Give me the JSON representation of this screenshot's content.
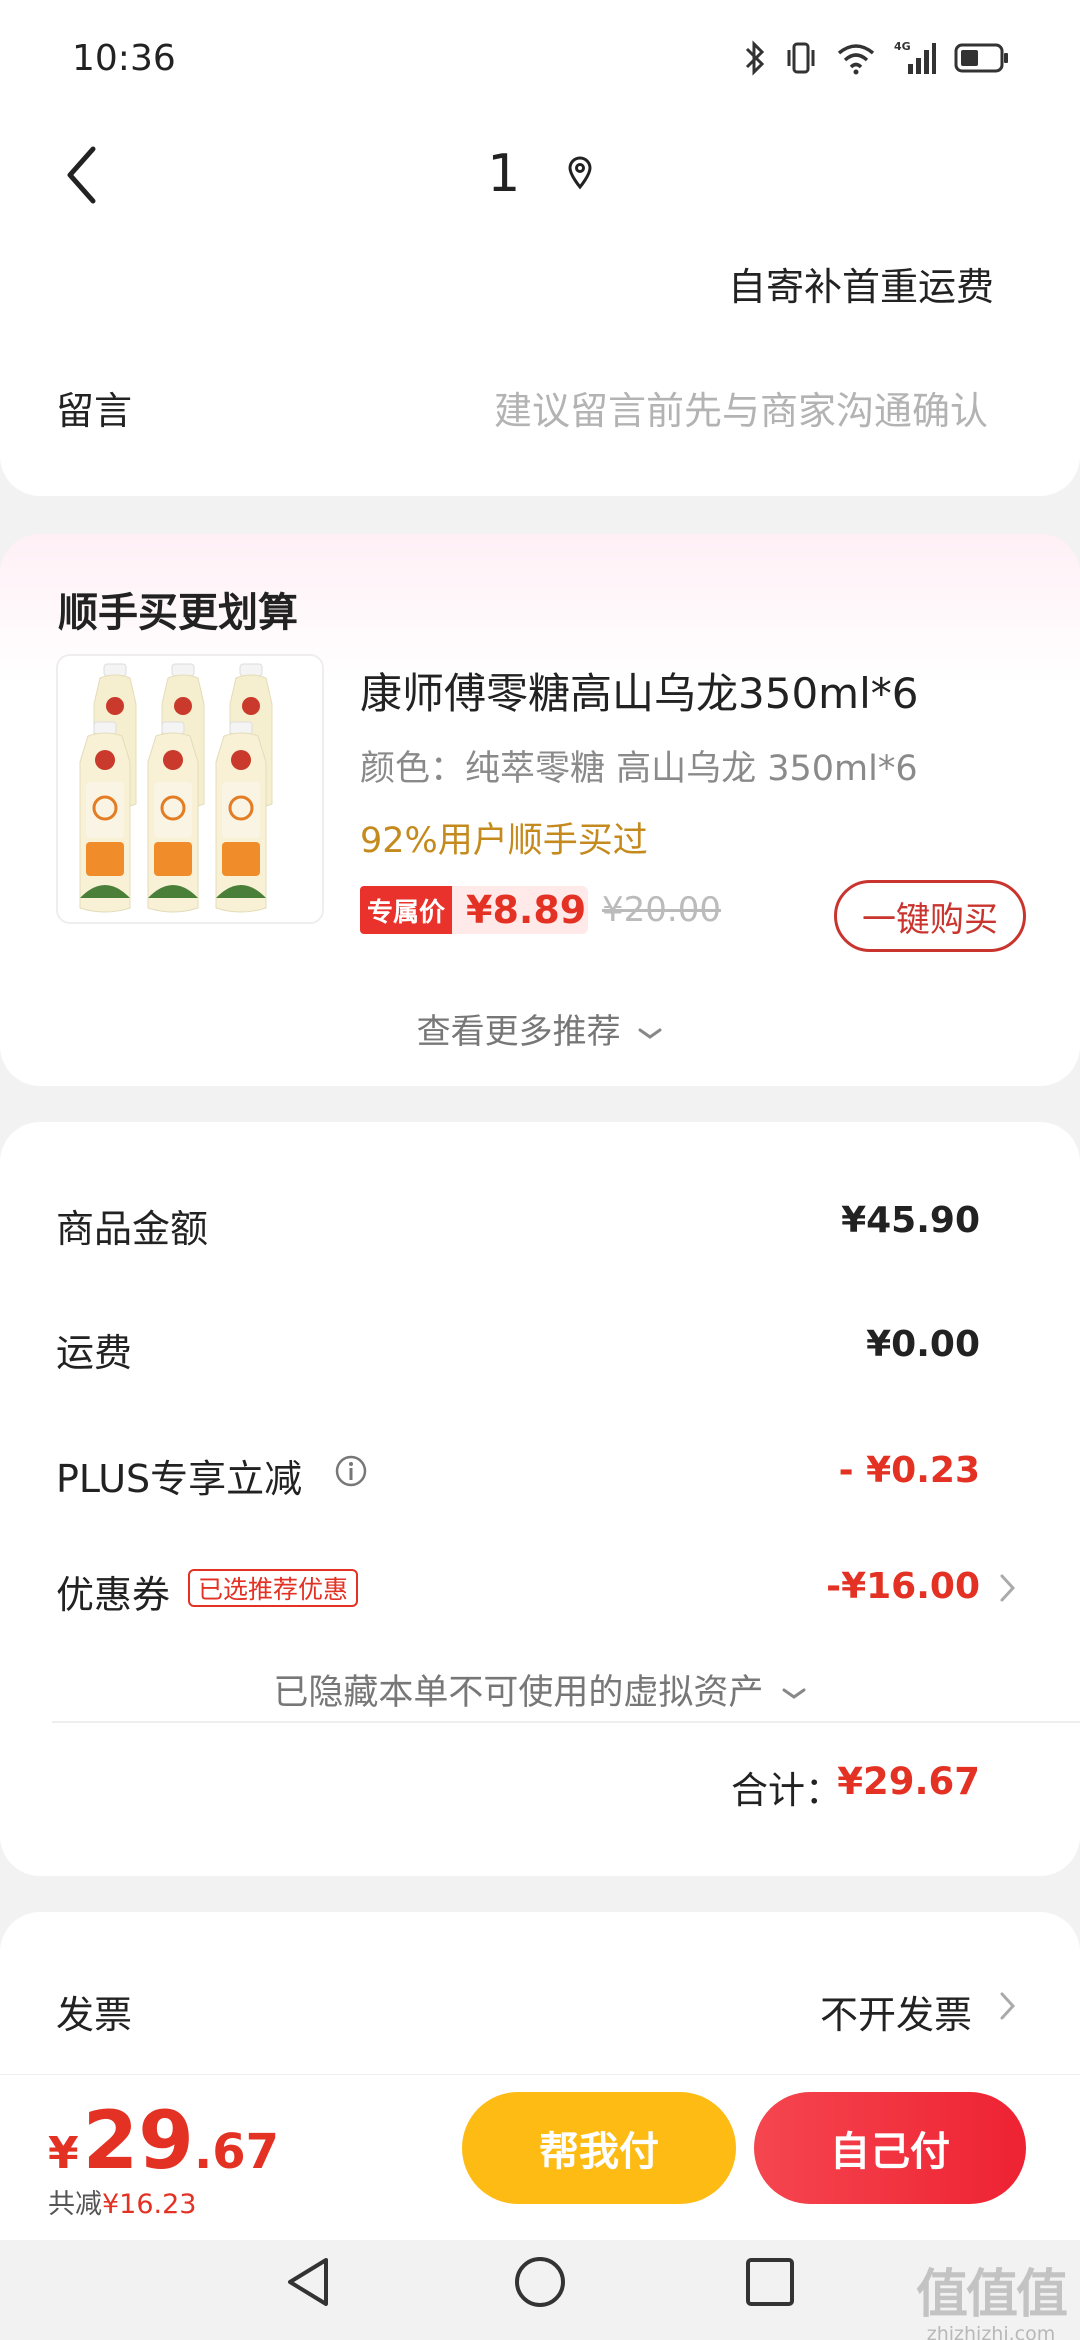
{
  "status_bar": {
    "time": "10:36",
    "network": "4G"
  },
  "header": {
    "title": "1"
  },
  "shipping_note": "自寄补首重运费",
  "message": {
    "label": "留言",
    "placeholder": "建议留言前先与商家沟通确认"
  },
  "recommend": {
    "title": "顺手买更划算",
    "product": {
      "name": "康师傅零糖高山乌龙350ml*6",
      "spec": "颜色：纯萃零糖 高山乌龙 350ml*6",
      "stat": "92%用户顺手买过",
      "price_tag": "专属价",
      "price": "¥8.89",
      "original_price": "¥20.00",
      "buy_label": "一键购买"
    },
    "more_label": "查看更多推荐"
  },
  "summary": {
    "goods_label": "商品金额",
    "goods_value": "¥45.90",
    "shipping_label": "运费",
    "shipping_value": "¥0.00",
    "plus_label": "PLUS专享立减",
    "plus_value": "- ¥0.23",
    "coupon_label": "优惠券",
    "coupon_badge": "已选推荐优惠",
    "coupon_value": "-¥16.00",
    "hidden_assets": "已隐藏本单不可使用的虚拟资产",
    "total_label": "合计：",
    "total_value": "¥29.67"
  },
  "invoice": {
    "label": "发票",
    "value": "不开发票"
  },
  "bottom": {
    "currency": "¥",
    "price_int": "29",
    "price_dec": ".67",
    "saved_label": "共减",
    "saved_value": "¥16.23",
    "help_pay": "帮我付",
    "self_pay": "自己付"
  },
  "watermark": {
    "mark": "值值值",
    "site": "zhizhizhi.com"
  },
  "colors": {
    "accent": "#e33124",
    "gold": "#fdbb13",
    "discount_text": "#c58a1d"
  }
}
